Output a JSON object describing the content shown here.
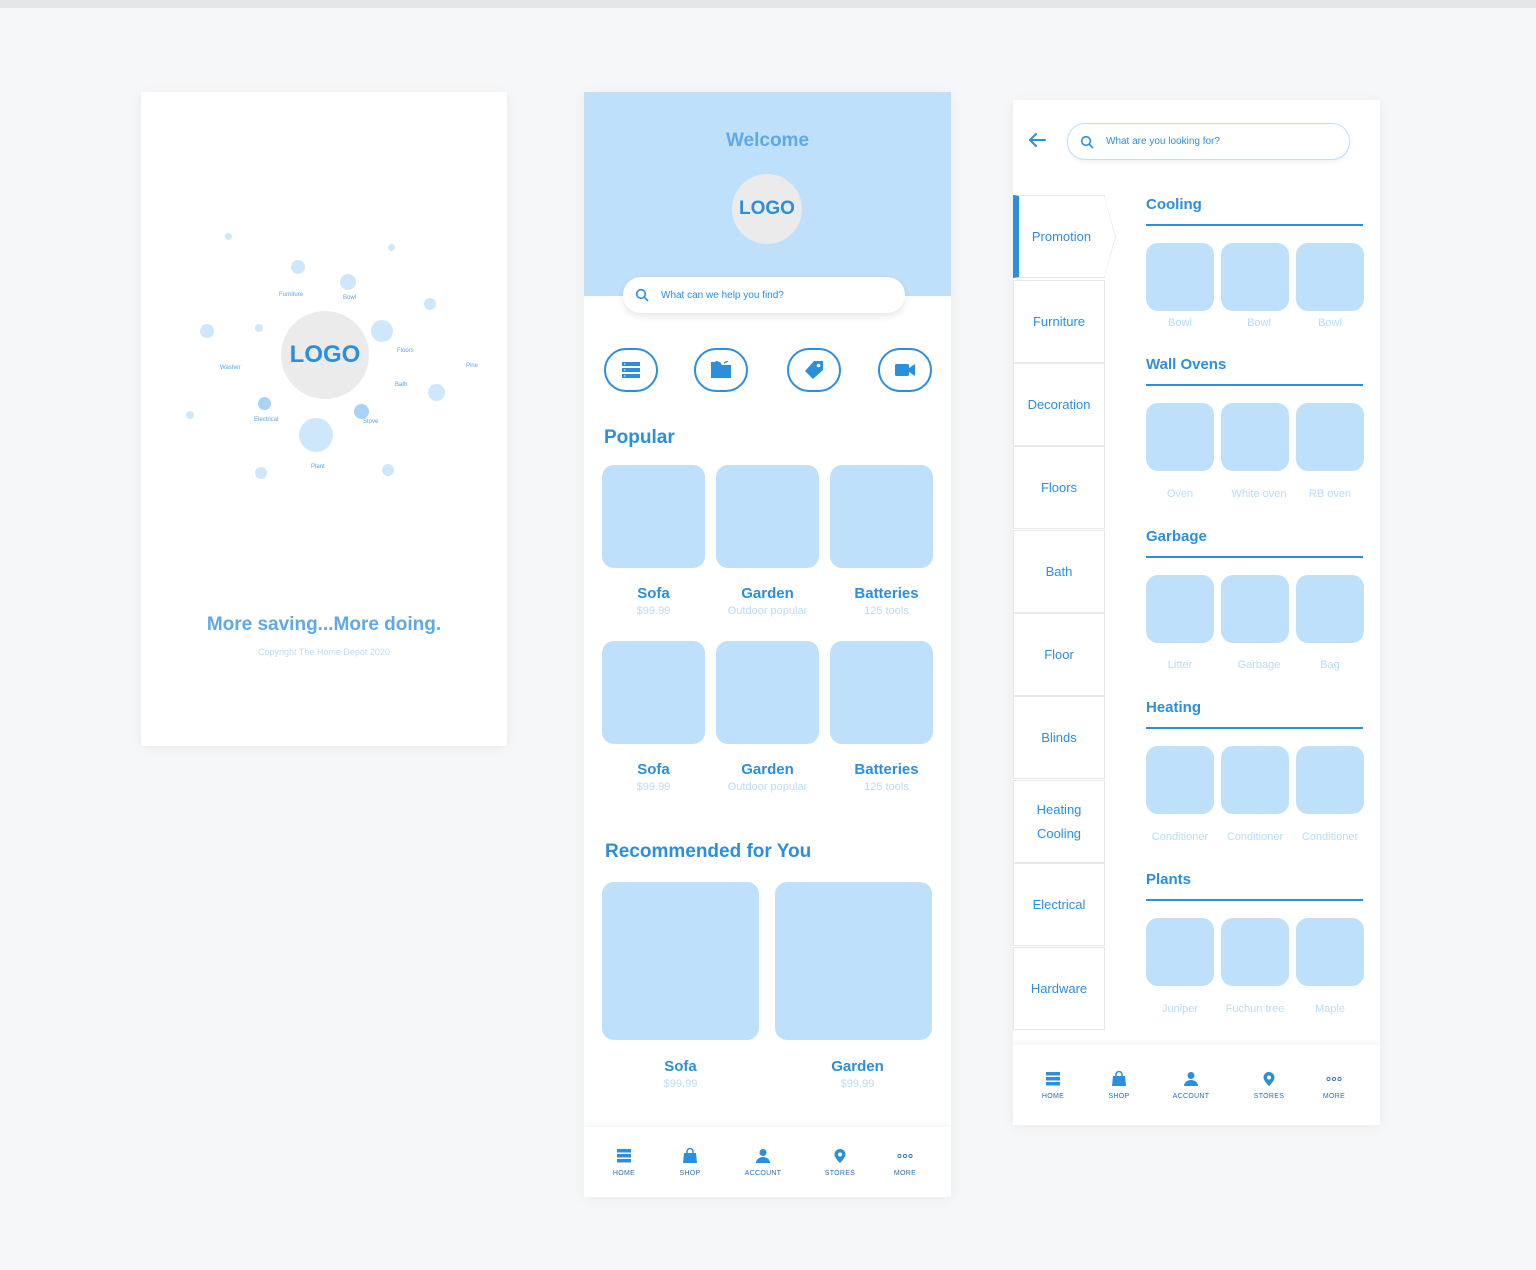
{
  "splash": {
    "logo": "LOGO",
    "tagline": "More saving...More doing.",
    "copyright": "Copyright The Home Depot 2020",
    "orbit_labels": [
      "Furniture",
      "Bowl",
      "Floors",
      "Pine",
      "Bath",
      "Stove",
      "Electrical",
      "Plant",
      "Washer"
    ]
  },
  "home": {
    "welcome": "Welcome",
    "logo": "LOGO",
    "search_placeholder": "What can we help you find?",
    "category_icons": [
      "list-icon",
      "folder-icon",
      "tag-icon",
      "video-camera-icon"
    ],
    "popular_title": "Popular",
    "popular": [
      {
        "name": "Sofa",
        "sub": "$99.99"
      },
      {
        "name": "Garden",
        "sub": "Outdoor popular"
      },
      {
        "name": "Batteries",
        "sub": "125 tools"
      },
      {
        "name": "Sofa",
        "sub": "$99.99"
      },
      {
        "name": "Garden",
        "sub": "Outdoor popular"
      },
      {
        "name": "Batteries",
        "sub": "125 tools"
      }
    ],
    "recommended_title": "Recommended for You",
    "recommended": [
      {
        "name": "Sofa",
        "sub": "$99.99"
      },
      {
        "name": "Garden",
        "sub": "$99.99"
      }
    ]
  },
  "nav": {
    "items": [
      {
        "label": "HOME",
        "icon": "home-icon"
      },
      {
        "label": "SHOP",
        "icon": "shopping-bag-icon"
      },
      {
        "label": "ACCOUNT",
        "icon": "account-icon"
      },
      {
        "label": "STORES",
        "icon": "location-pin-icon"
      },
      {
        "label": "MORE",
        "icon": "more-dots-icon"
      }
    ]
  },
  "category": {
    "search_placeholder": "What are you looking for?",
    "sidebar": [
      {
        "label": "Promotion",
        "active": true
      },
      {
        "label": "Furniture"
      },
      {
        "label": "Decoration"
      },
      {
        "label": "Floors"
      },
      {
        "label": "Bath"
      },
      {
        "label": "Floor"
      },
      {
        "label": "Blinds"
      },
      {
        "label": "Heating Cooling",
        "line1": "Heating",
        "line2": "Cooling"
      },
      {
        "label": "Electrical"
      },
      {
        "label": "Hardware"
      }
    ],
    "sections": [
      {
        "title": "Cooling",
        "items": [
          "Bowl",
          "Bowl",
          "Bowl"
        ]
      },
      {
        "title": "Wall Ovens",
        "items": [
          "Oven",
          "White oven",
          "RB oven"
        ]
      },
      {
        "title": "Garbage",
        "items": [
          "Litter",
          "Garbage",
          "Bag"
        ]
      },
      {
        "title": "Heating",
        "items": [
          "Conditioner",
          "Conditioner",
          "Conditioner"
        ]
      },
      {
        "title": "Plants",
        "items": [
          "Juniper",
          "Fuchun tree",
          "Maple"
        ]
      }
    ]
  },
  "colors": {
    "accent": "#2b8fdd",
    "light_tile": "#bfe0fb",
    "muted_text": "#b9dcf6",
    "background": "#f6f7f8"
  }
}
